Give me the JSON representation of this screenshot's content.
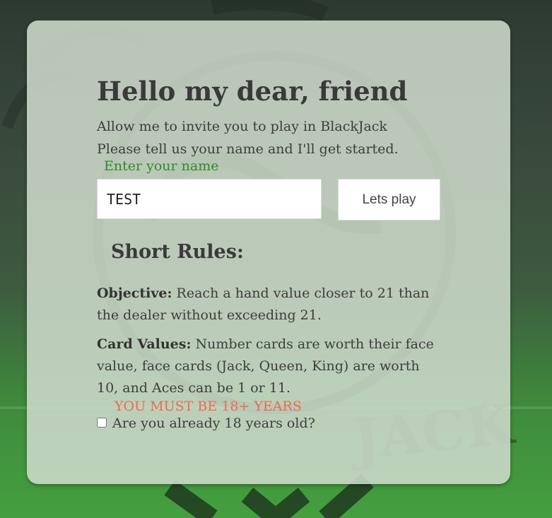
{
  "colors": {
    "card_background": "#cddacb",
    "label_green": "#2f8a2a",
    "warning_red": "#ee6a52",
    "text_dark": "#3a3a3a"
  },
  "greeting": {
    "title": "Hello my dear, friend",
    "line1": "Allow me to invite you to play in BlackJack",
    "line2": "Please tell us your name and I'll get started."
  },
  "name_form": {
    "label": "Enter your name",
    "value": "TEST",
    "button_label": "Lets play"
  },
  "rules": {
    "heading": "Short Rules:",
    "objective_label": "Objective:",
    "objective_text": " Reach a hand value closer to 21 than the dealer without exceeding 21.",
    "card_values_label": "Card Values:",
    "card_values_text": " Number cards are worth their face value, face cards (Jack, Queen, King) are worth 10, and Aces can be 1 or 11."
  },
  "age_check": {
    "warning": "YOU MUST BE 18+ YEARS",
    "label": "Are you already 18 years old?",
    "checked": false
  },
  "background": {
    "logo_text": "JACK"
  }
}
